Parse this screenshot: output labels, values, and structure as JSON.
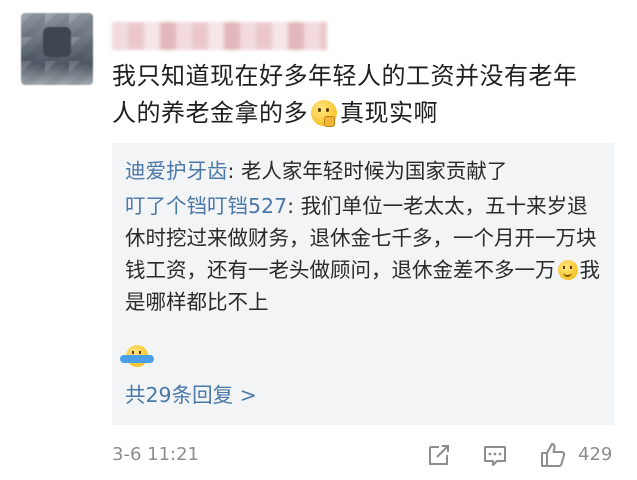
{
  "comment": {
    "text_line1": "我只知道现在好多年轻人的工资并没有老年",
    "text_line2_before": "人的养老金拿的多",
    "text_line2_after": "真现实啊",
    "emoji": "thinking-emoji"
  },
  "replies": [
    {
      "user": "迪爱护牙齿",
      "sep": ": ",
      "text": "老人家年轻时候为国家贡献了"
    },
    {
      "user": "叮了个铛叮铛527",
      "sep": ": ",
      "text_before": "我们单位一老太太，五十来岁退休时挖过来做财务，退休金七千多，一个月开一万块钱工资，还有一老头做顾问，退休金差不多一万",
      "text_after": "我是哪样都比不上",
      "emojis": [
        "smile-emoji",
        "shrug-emoji"
      ]
    }
  ],
  "more_replies": "共29条回复 >",
  "footer": {
    "timestamp": "3-6 11:21",
    "like_count": "429",
    "icons": [
      "share-icon",
      "comment-icon",
      "like-icon"
    ]
  },
  "colors": {
    "link": "#4a78a8",
    "reply_bg": "#f3f4f6",
    "meta_text": "#8d8d8d"
  }
}
